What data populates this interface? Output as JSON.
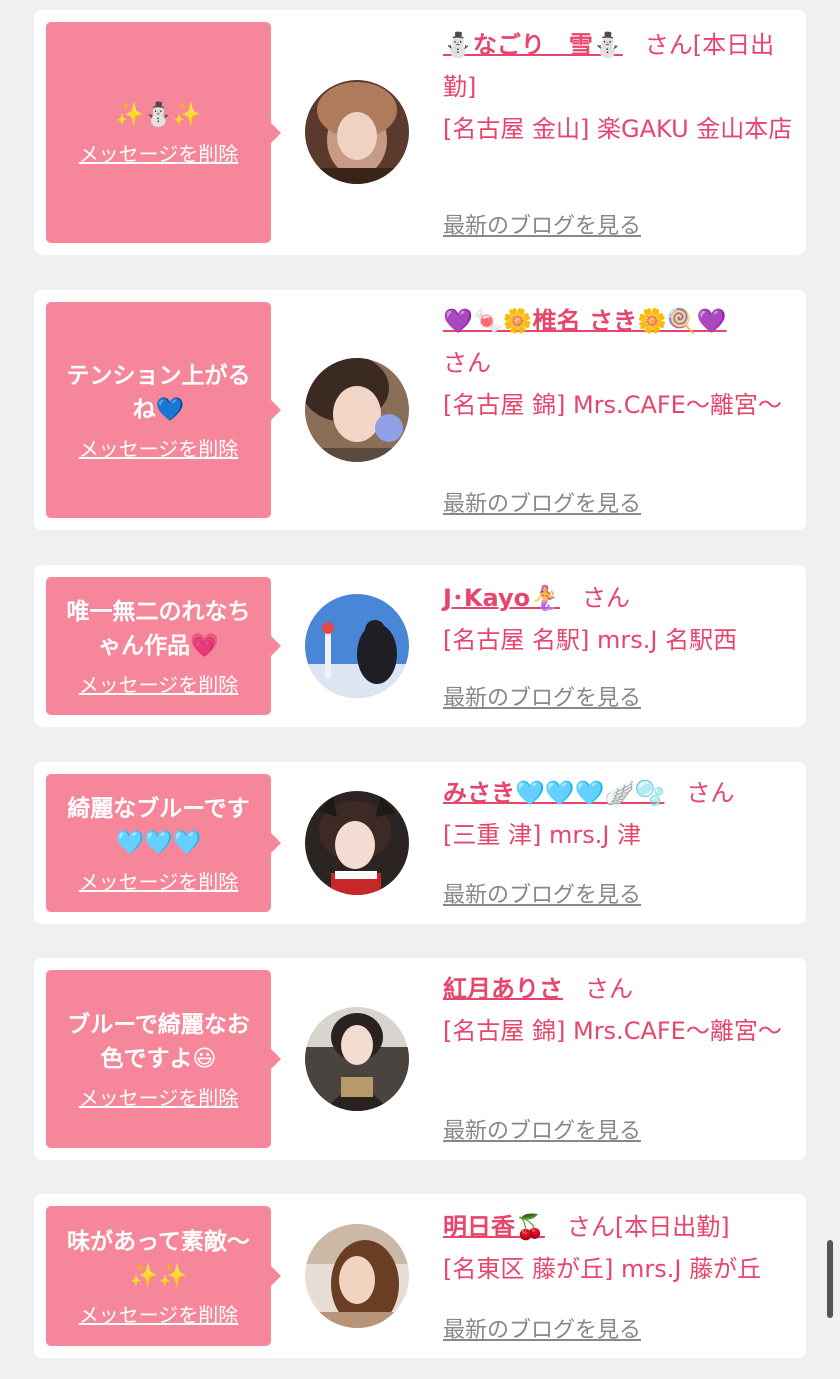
{
  "delete_label": "メッセージを削除",
  "blog_label": "最新のブログを見る",
  "san_label": "さん",
  "colors": {
    "accent": "#e8456d",
    "bubble": "#f6879a",
    "link_gray": "#888888",
    "background": "#f0f0f0"
  },
  "messages": [
    {
      "message": "✨⛄✨",
      "name": "⛄なごり　雪⛄",
      "status": "[本日出勤]",
      "shop": "[名古屋 金山] 楽GAKU 金山本店",
      "avatar_icon": "avatar-photo"
    },
    {
      "message": "テンション上がるね💙",
      "name": "💜🍬🌼椎名 さき🌼🍭💜",
      "status": "",
      "shop": "[名古屋 錦] Mrs.CAFE〜離宮〜",
      "avatar_icon": "avatar-photo"
    },
    {
      "message": "唯一無二のれなちゃん作品💗",
      "name": "J･Kayo🧜‍♀️",
      "status": "",
      "shop": "[名古屋 名駅] mrs.J 名駅西",
      "avatar_icon": "avatar-photo"
    },
    {
      "message": "綺麗なブルーです🩵🩵🩵",
      "name": "みさき🩵🩵🩵🪽🫧",
      "status": "",
      "shop": "[三重 津] mrs.J 津",
      "avatar_icon": "avatar-photo"
    },
    {
      "message": "ブルーで綺麗なお色ですよ😃",
      "name": "紅月ありさ",
      "status": "",
      "shop": "[名古屋 錦] Mrs.CAFE〜離宮〜",
      "avatar_icon": "avatar-photo"
    },
    {
      "message": "味があって素敵〜✨✨",
      "name": "明日香🍒",
      "status": "[本日出勤]",
      "shop": "[名東区 藤が丘] mrs.J 藤が丘",
      "avatar_icon": "avatar-photo"
    }
  ]
}
